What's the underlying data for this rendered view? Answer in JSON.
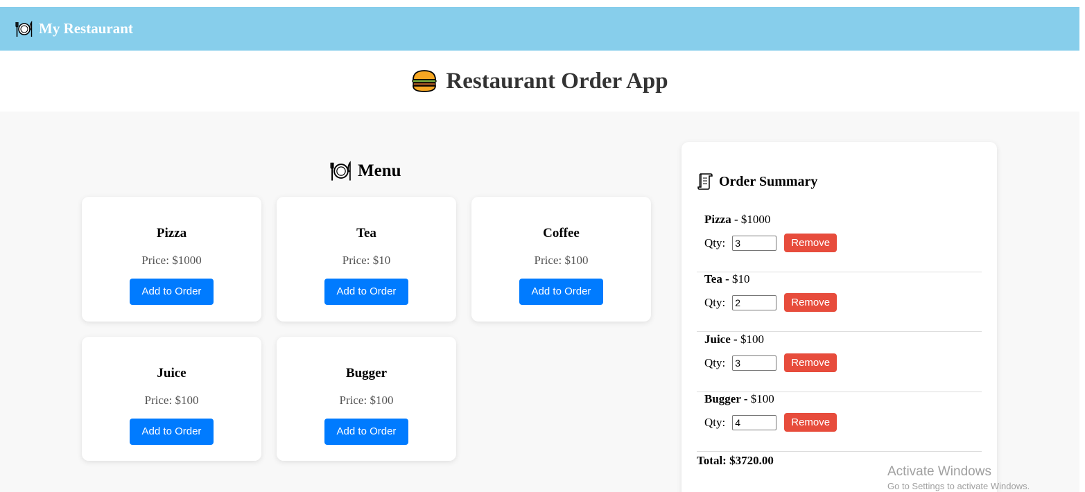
{
  "navbar": {
    "title": "My Restaurant",
    "icon": "plate-cutlery-icon"
  },
  "hero": {
    "title": "Restaurant Order App",
    "icon": "burger-icon"
  },
  "menu": {
    "heading": "Menu",
    "icon": "plate-cutlery-icon",
    "items": [
      {
        "name": "Pizza",
        "price": "Price: $1000",
        "button": "Add to Order"
      },
      {
        "name": "Tea",
        "price": "Price: $10",
        "button": "Add to Order"
      },
      {
        "name": "Coffee",
        "price": "Price: $100",
        "button": "Add to Order"
      },
      {
        "name": "Juice",
        "price": "Price: $100",
        "button": "Add to Order"
      },
      {
        "name": "Bugger",
        "price": "Price: $100",
        "button": "Add to Order"
      }
    ]
  },
  "summary": {
    "heading": "Order Summary",
    "icon": "scroll-icon",
    "qty_label": "Qty:",
    "remove_label": "Remove",
    "items": [
      {
        "name": "Pizza -",
        "price": "$1000",
        "qty": "3"
      },
      {
        "name": "Tea -",
        "price": "$10",
        "qty": "2"
      },
      {
        "name": "Juice -",
        "price": "$100",
        "qty": "3"
      },
      {
        "name": "Bugger -",
        "price": "$100",
        "qty": "4"
      }
    ],
    "total": "Total: $3720.00"
  },
  "watermark": {
    "title": "Activate Windows",
    "subtitle": "Go to Settings to activate Windows."
  },
  "colors": {
    "navbar_bg": "#87ceeb",
    "add_button": "#007bff",
    "remove_button": "#e74c3c",
    "content_bg": "#f8f8f8"
  }
}
